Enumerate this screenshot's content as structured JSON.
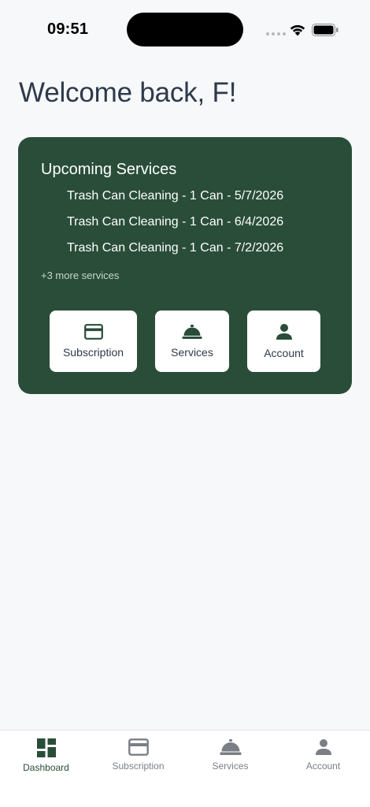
{
  "status_bar": {
    "time": "09:51"
  },
  "header": {
    "welcome": "Welcome back, F!"
  },
  "upcoming": {
    "title": "Upcoming Services",
    "items": [
      "Trash Can Cleaning - 1 Can - 5/7/2026",
      "Trash Can Cleaning - 1 Can - 6/4/2026",
      "Trash Can Cleaning - 1 Can - 7/2/2026"
    ],
    "more": "+3 more services",
    "quick_actions": [
      {
        "label": "Subscription",
        "icon": "credit-card-icon"
      },
      {
        "label": "Services",
        "icon": "service-bell-icon"
      },
      {
        "label": "Account",
        "icon": "person-icon"
      }
    ]
  },
  "bottom_nav": {
    "items": [
      {
        "label": "Dashboard",
        "icon": "dashboard-icon",
        "active": true
      },
      {
        "label": "Subscription",
        "icon": "credit-card-icon",
        "active": false
      },
      {
        "label": "Services",
        "icon": "service-bell-icon",
        "active": false
      },
      {
        "label": "Account",
        "icon": "person-icon",
        "active": false
      }
    ]
  },
  "colors": {
    "brand_green": "#294d39",
    "background": "#f7f8fa",
    "heading_text": "#2d3a4b",
    "inactive_nav": "#7a7f86"
  }
}
